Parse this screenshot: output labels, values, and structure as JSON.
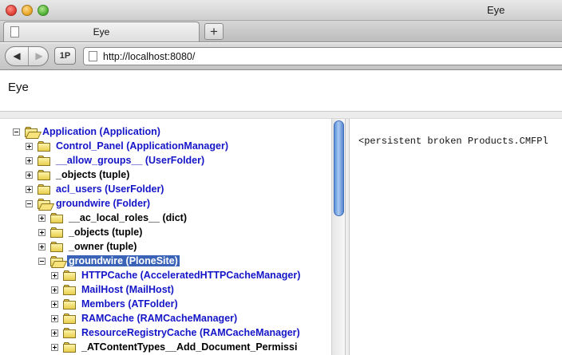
{
  "window": {
    "title": "Eye"
  },
  "tabs": [
    {
      "label": "Eye"
    }
  ],
  "toolbar": {
    "back_icon": "back-arrow",
    "forward_icon": "forward-arrow",
    "onepassword_label": "1P",
    "new_tab_label": "+",
    "url": "http://localhost:8080/"
  },
  "page": {
    "heading": "Eye"
  },
  "tree": [
    {
      "label": "Application (Application)",
      "link": true
    },
    {
      "label": "Control_Panel (ApplicationManager)",
      "link": true
    },
    {
      "label": "__allow_groups__ (UserFolder)",
      "link": true
    },
    {
      "label": "_objects (tuple)",
      "link": false
    },
    {
      "label": "acl_users (UserFolder)",
      "link": true
    },
    {
      "label": "groundwire (Folder)",
      "link": true
    },
    {
      "label": "__ac_local_roles__ (dict)",
      "link": false
    },
    {
      "label": "_objects (tuple)",
      "link": false
    },
    {
      "label": "_owner (tuple)",
      "link": false
    },
    {
      "label": "groundwire (PloneSite)",
      "link": true,
      "selected": true
    },
    {
      "label": "HTTPCache (AcceleratedHTTPCacheManager)",
      "link": true
    },
    {
      "label": "MailHost (MailHost)",
      "link": true
    },
    {
      "label": "Members (ATFolder)",
      "link": true
    },
    {
      "label": "RAMCache (RAMCacheManager)",
      "link": true
    },
    {
      "label": "ResourceRegistryCache (RAMCacheManager)",
      "link": true
    },
    {
      "label": "_ATContentTypes__Add_Document_Permissi",
      "link": false
    }
  ],
  "detail": {
    "text": "<persistent broken Products.CMFPl"
  },
  "colors": {
    "link": "#1515c8",
    "selection": "#3a63b8",
    "folder": "#e9cf4d"
  }
}
